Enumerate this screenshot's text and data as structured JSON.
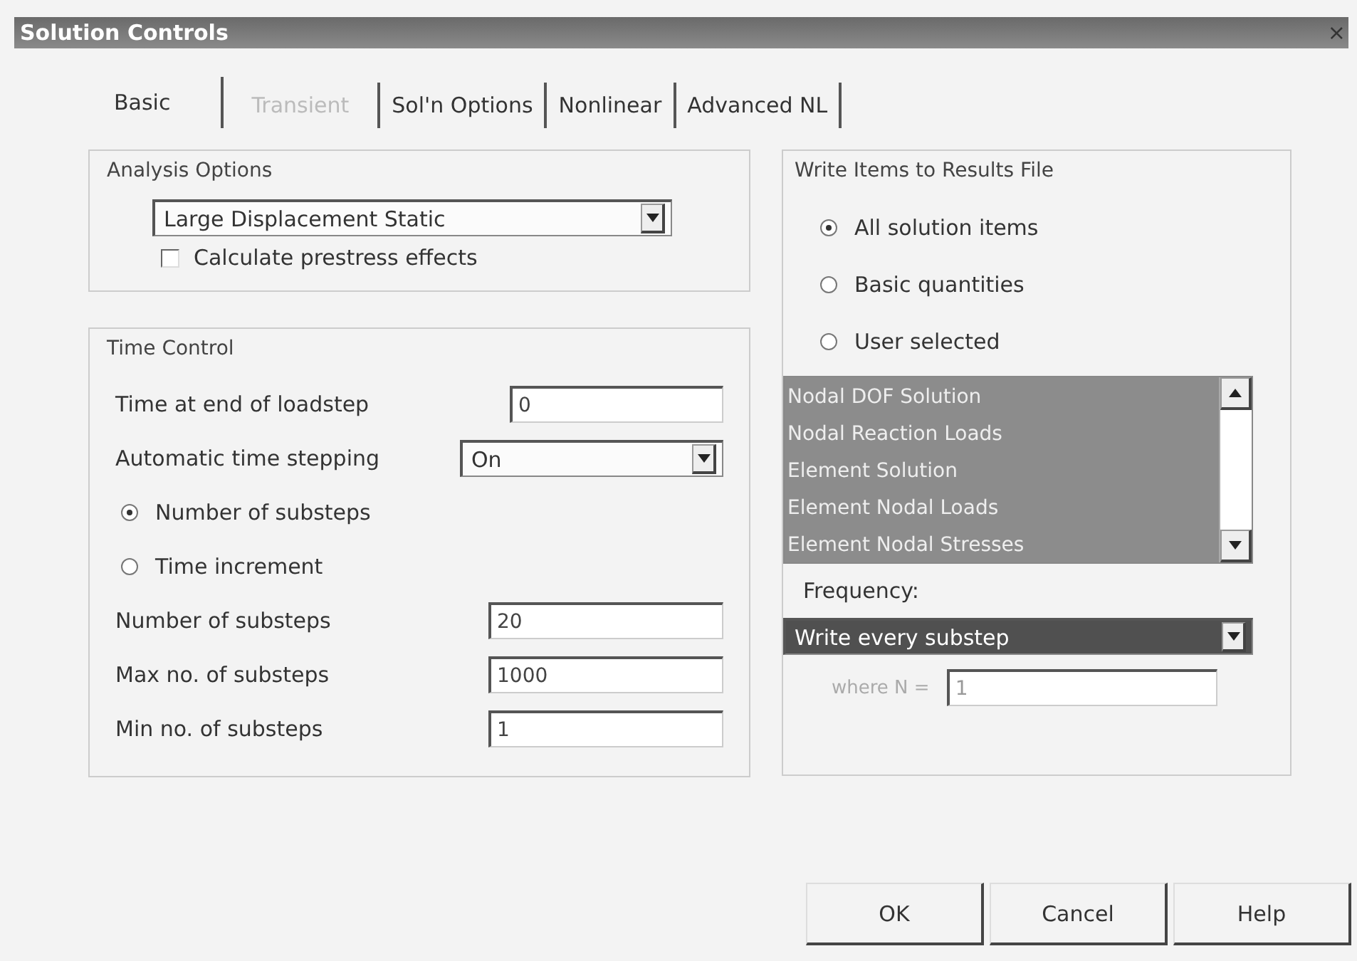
{
  "window": {
    "title": "Solution Controls",
    "close": "×"
  },
  "tabs": [
    {
      "label": "Basic",
      "selected": true,
      "disabled": false
    },
    {
      "label": "Transient",
      "selected": false,
      "disabled": true
    },
    {
      "label": "Sol'n Options",
      "selected": false,
      "disabled": false
    },
    {
      "label": "Nonlinear",
      "selected": false,
      "disabled": false
    },
    {
      "label": "Advanced NL",
      "selected": false,
      "disabled": false
    }
  ],
  "analysis_options": {
    "title": "Analysis Options",
    "dropdown": "Large Displacement Static",
    "checkbox": {
      "label": "Calculate prestress effects",
      "checked": false
    }
  },
  "time_control": {
    "title": "Time Control",
    "rows": [
      {
        "kind": "field",
        "label": "Time at end of loadstep",
        "value": "0"
      },
      {
        "kind": "dropdown",
        "label": "Automatic time stepping",
        "value": "On"
      },
      {
        "kind": "radio",
        "label": "Number of substeps",
        "selected": true
      },
      {
        "kind": "radio",
        "label": "Time increment",
        "selected": false
      },
      {
        "kind": "field",
        "label": "Number of substeps",
        "value": "20"
      },
      {
        "kind": "field",
        "label": "Max no. of substeps",
        "value": "1000"
      },
      {
        "kind": "field",
        "label": "Min no. of substeps",
        "value": "1"
      }
    ]
  },
  "results": {
    "title": "Write Items to Results File",
    "radios": [
      {
        "label": "All solution items",
        "selected": true
      },
      {
        "label": "Basic quantities",
        "selected": false
      },
      {
        "label": "User selected",
        "selected": false
      }
    ],
    "list": [
      {
        "label": "Nodal DOF Solution",
        "selected": true
      },
      {
        "label": "Nodal Reaction Loads",
        "selected": true
      },
      {
        "label": "Element Solution",
        "selected": true
      },
      {
        "label": "Element Nodal Loads",
        "selected": true
      },
      {
        "label": "Element Nodal Stresses",
        "selected": true
      }
    ],
    "frequency_label": "Frequency:",
    "frequency": "Write every substep",
    "where_n": {
      "label": "where N =",
      "value": "1",
      "disabled": true
    }
  },
  "buttons": [
    "OK",
    "Cancel",
    "Help"
  ]
}
